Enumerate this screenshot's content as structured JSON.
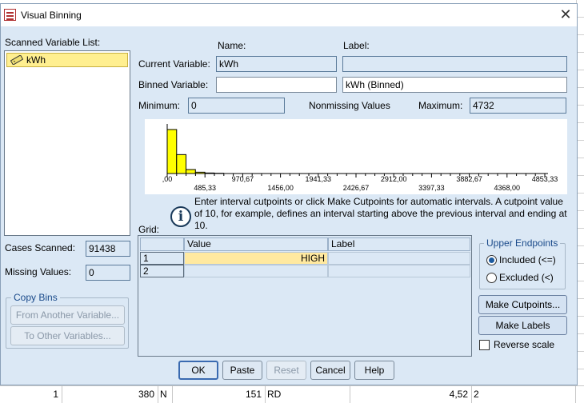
{
  "window": {
    "title": "Visual Binning"
  },
  "scanned_list": {
    "label": "Scanned Variable List:",
    "items": [
      "kWh"
    ]
  },
  "headers": {
    "name": "Name:",
    "label": "Label:"
  },
  "current_variable": {
    "label": "Current Variable:",
    "name": "kWh",
    "label_value": ""
  },
  "binned_variable": {
    "label": "Binned Variable:",
    "name": "",
    "label_value": "kWh (Binned)"
  },
  "stats": {
    "minimum_label": "Minimum:",
    "minimum": "0",
    "nonmissing_label": "Nonmissing Values",
    "maximum_label": "Maximum:",
    "maximum": "4732",
    "cases_scanned_label": "Cases Scanned:",
    "cases_scanned": "91438",
    "missing_values_label": "Missing Values:",
    "missing_values": "0"
  },
  "chart_data": {
    "type": "bar",
    "bar_color": "#ffff00",
    "x_ticks_top": [
      ",00",
      "970,67",
      "1941,33",
      "2912,00",
      "3882,67",
      "4853,33"
    ],
    "x_ticks_bottom": [
      "485,33",
      "1456,00",
      "2426,67",
      "3397,33",
      "4368,00"
    ],
    "xlim": [
      0,
      4853.33
    ],
    "bins": [
      {
        "start": 0,
        "end": 121,
        "height": 1.0
      },
      {
        "start": 121,
        "end": 242,
        "height": 0.43
      },
      {
        "start": 242,
        "end": 363,
        "height": 0.09
      },
      {
        "start": 363,
        "end": 484,
        "height": 0.03
      },
      {
        "start": 484,
        "end": 605,
        "height": 0.012
      },
      {
        "start": 605,
        "end": 726,
        "height": 0.006
      }
    ]
  },
  "info": {
    "text": "Enter interval cutpoints or click Make Cutpoints for automatic intervals. A cutpoint value of 10, for example, defines an interval starting above the previous interval and ending at 10."
  },
  "grid": {
    "label": "Grid:",
    "columns": [
      "Value",
      "Label"
    ],
    "rows": [
      {
        "num": "1",
        "value": "HIGH",
        "label": ""
      },
      {
        "num": "2",
        "value": "",
        "label": ""
      }
    ]
  },
  "copy_bins": {
    "title": "Copy Bins",
    "from_label": "From Another Variable...",
    "to_label": "To Other Variables..."
  },
  "upper_endpoints": {
    "title": "Upper Endpoints",
    "included": "Included (<=)",
    "excluded": "Excluded (<)"
  },
  "side_buttons": {
    "make_cutpoints": "Make Cutpoints...",
    "make_labels": "Make Labels",
    "reverse_scale": "Reverse scale"
  },
  "buttons": {
    "ok": "OK",
    "paste": "Paste",
    "reset": "Reset",
    "cancel": "Cancel",
    "help": "Help"
  },
  "background_sheet": {
    "row": [
      "1",
      "380",
      "N",
      "151",
      "RD",
      "4,52",
      "2"
    ]
  }
}
